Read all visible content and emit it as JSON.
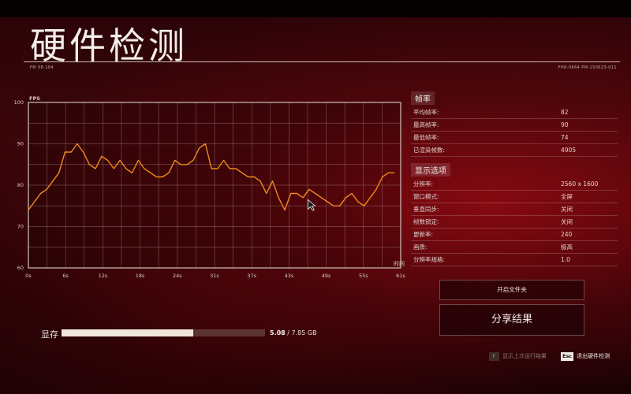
{
  "header": {
    "title": "硬件检测",
    "code_left": "FM 08-184",
    "code_right": "FHR-0664 PM-150023-011"
  },
  "chart_data": {
    "type": "line",
    "ylabel": "FPS",
    "xlabel": "时间",
    "ylim": [
      60,
      100
    ],
    "yticks": [
      100,
      90,
      80,
      70,
      60
    ],
    "xlim": [
      0,
      61
    ],
    "xticks": [
      "0s",
      "6s",
      "12s",
      "18s",
      "24s",
      "31s",
      "37s",
      "43s",
      "49s",
      "55s",
      "61s"
    ],
    "grid": true,
    "color": "#f08a1c",
    "x": [
      0,
      1,
      2,
      3,
      4,
      5,
      6,
      7,
      8,
      9,
      10,
      11,
      12,
      13,
      14,
      15,
      16,
      17,
      18,
      19,
      20,
      21,
      22,
      23,
      24,
      25,
      26,
      27,
      28,
      29,
      30,
      31,
      32,
      33,
      34,
      35,
      36,
      37,
      38,
      39,
      40,
      41,
      42,
      43,
      44,
      45,
      46,
      47,
      48,
      49,
      50,
      51,
      52,
      53,
      54,
      55,
      56,
      57,
      58,
      59,
      60,
      61
    ],
    "values": [
      74,
      76,
      78,
      79,
      81,
      83,
      88,
      88,
      90,
      88,
      85,
      84,
      87,
      86,
      84,
      86,
      84,
      83,
      86,
      84,
      83,
      82,
      82,
      83,
      86,
      85,
      85,
      86,
      89,
      90,
      84,
      84,
      86,
      84,
      84,
      83,
      82,
      82,
      81,
      78,
      81,
      77,
      74,
      78,
      78,
      77,
      79,
      78,
      77,
      76,
      75,
      75,
      77,
      78,
      76,
      75,
      77,
      79,
      82,
      83,
      83
    ]
  },
  "stats": {
    "framerate_title": "帧率",
    "framerate_rows": [
      {
        "label": "平均帧率:",
        "value": "82"
      },
      {
        "label": "最高帧率:",
        "value": "90"
      },
      {
        "label": "最低帧率:",
        "value": "74"
      },
      {
        "label": "已渲染帧数:",
        "value": "4905"
      }
    ],
    "display_title": "显示选项",
    "display_rows": [
      {
        "label": "分辨率:",
        "value": "2560 x 1600"
      },
      {
        "label": "窗口模式:",
        "value": "全屏"
      },
      {
        "label": "垂直同步:",
        "value": "关闭"
      },
      {
        "label": "帧数锁定:",
        "value": "关闭"
      },
      {
        "label": "更新率:",
        "value": "240"
      },
      {
        "label": "画质:",
        "value": "极高"
      },
      {
        "label": "分辨率规格:",
        "value": "1.0"
      }
    ]
  },
  "buttons": {
    "open_folder": "开启文件夹",
    "share": "分享结果"
  },
  "memory": {
    "label": "显存",
    "used": "5.08",
    "total": "/ 7.85 GB",
    "used_fraction": 0.647
  },
  "hints": {
    "prev_key": "F",
    "prev_label": "显示上次运行结果",
    "exit_key": "Esc",
    "exit_label": "退出硬件检测"
  }
}
